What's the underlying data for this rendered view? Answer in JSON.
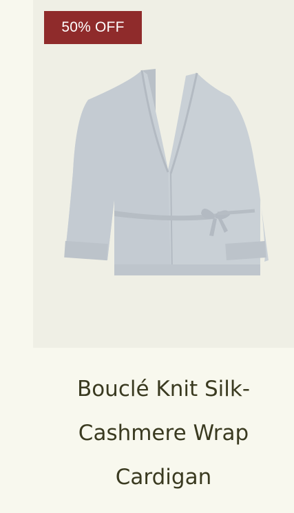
{
  "product": {
    "badge": "50% OFF",
    "image_icon": "cardigan-product-image",
    "title_lines": [
      "Bouclé Knit Silk-",
      "Cashmere Wrap",
      "Cardigan"
    ]
  },
  "colors": {
    "page_background": "#f8f8ee",
    "image_background": "#efefe5",
    "badge_background": "#8f2b2b",
    "title_text": "#3a3a20",
    "cardigan": "#c9d0d6"
  }
}
